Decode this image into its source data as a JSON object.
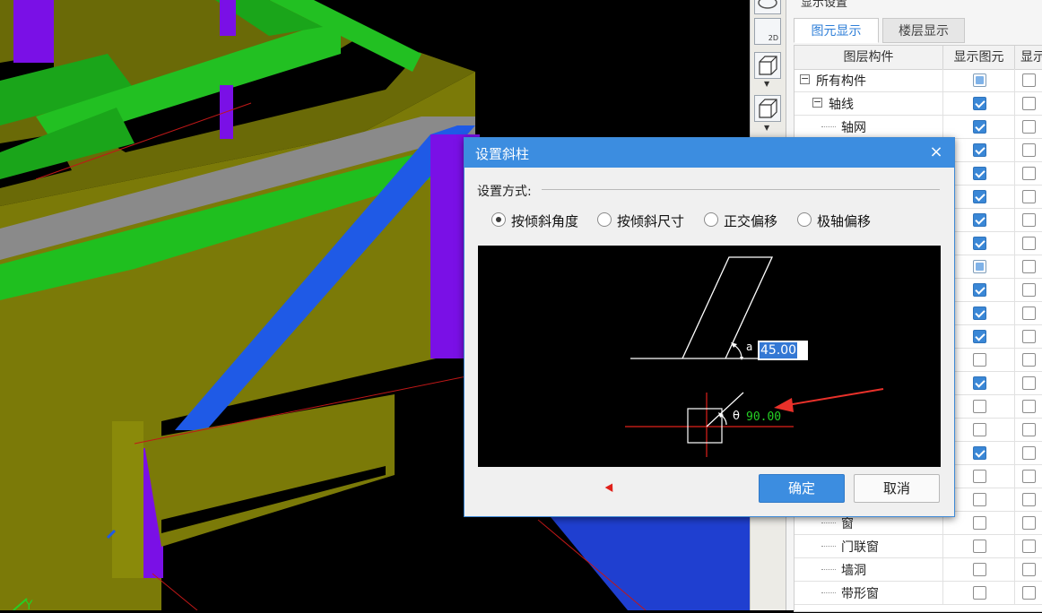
{
  "viewport": {
    "axis_label": "Y"
  },
  "panel": {
    "title": "显示设置",
    "tabs": [
      {
        "label": "图元显示",
        "active": true
      },
      {
        "label": "楼层显示",
        "active": false
      }
    ],
    "columns": [
      "图层构件",
      "显示图元",
      "显示"
    ],
    "rows": [
      {
        "label": "所有构件",
        "level": 0,
        "expander": "−",
        "state": "partial"
      },
      {
        "label": "轴线",
        "level": 1,
        "expander": "−",
        "state": "checked"
      },
      {
        "label": "轴网",
        "level": 2,
        "state": "checked"
      },
      {
        "label": "",
        "level": 2,
        "state": "checked"
      },
      {
        "label": "",
        "level": 2,
        "state": "checked"
      },
      {
        "label": "",
        "level": 2,
        "state": "checked"
      },
      {
        "label": "",
        "level": 2,
        "state": "checked"
      },
      {
        "label": "",
        "level": 2,
        "state": "checked"
      },
      {
        "label": "",
        "level": 2,
        "state": "partial"
      },
      {
        "label": "",
        "level": 2,
        "state": "checked"
      },
      {
        "label": "",
        "level": 2,
        "state": "checked"
      },
      {
        "label": "",
        "level": 2,
        "state": "checked"
      },
      {
        "label": "",
        "level": 2,
        "state": "unchecked"
      },
      {
        "label": "",
        "level": 2,
        "state": "checked"
      },
      {
        "label": "",
        "level": 2,
        "state": "unchecked"
      },
      {
        "label": "",
        "level": 2,
        "state": "unchecked"
      },
      {
        "label": "",
        "level": 2,
        "state": "checked"
      },
      {
        "label": "",
        "level": 2,
        "state": "unchecked"
      },
      {
        "label": "",
        "level": 2,
        "state": "unchecked"
      },
      {
        "label": "窗",
        "level": 2,
        "state": "unchecked"
      },
      {
        "label": "门联窗",
        "level": 2,
        "state": "unchecked"
      },
      {
        "label": "墙洞",
        "level": 2,
        "state": "unchecked"
      },
      {
        "label": "带形窗",
        "level": 2,
        "state": "unchecked"
      }
    ]
  },
  "toolbar": {
    "view_2d_label": "2D"
  },
  "dialog": {
    "title": "设置斜柱",
    "close_glyph": "×",
    "group_label": "设置方式:",
    "options": [
      {
        "label": "按倾斜角度",
        "selected": true
      },
      {
        "label": "按倾斜尺寸",
        "selected": false
      },
      {
        "label": "正交偏移",
        "selected": false
      },
      {
        "label": "极轴偏移",
        "selected": false
      }
    ],
    "preview": {
      "alpha_symbol": "a",
      "angle_value": "45.00",
      "theta_symbol": "θ",
      "theta_value": "90.00"
    },
    "ok_label": "确定",
    "cancel_label": "取消"
  },
  "colors": {
    "accent": "#3c8de0",
    "check": "#3a87d6",
    "theta_text": "#25d024",
    "annotation_arrow": "#e8312a"
  }
}
